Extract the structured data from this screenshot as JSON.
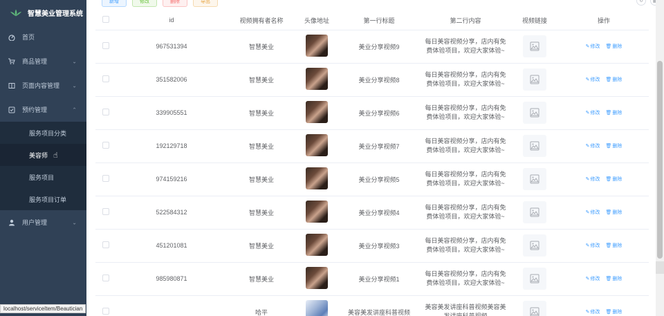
{
  "sidebar": {
    "title": "智慧美业管理系统",
    "menu": [
      {
        "label": "首页",
        "icon": "dashboard-icon"
      },
      {
        "label": "商品管理",
        "icon": "cart-icon"
      },
      {
        "label": "页面内容管理",
        "icon": "book-icon"
      },
      {
        "label": "预约管理",
        "icon": "check-square-icon"
      }
    ],
    "submenu": [
      "服务项目分类",
      "美容师",
      "服务项目",
      "服务项目订单"
    ],
    "user_menu": {
      "label": "用户管理",
      "icon": "user-icon"
    }
  },
  "status_url": "localhost/serviceItem/Beautician",
  "toolbar": {
    "add": "新增",
    "edit": "修改",
    "delete": "删除",
    "export": "导出"
  },
  "table": {
    "headers": [
      "id",
      "视频拥有者名称",
      "头像地址",
      "第一行标题",
      "第二行内容",
      "视频链接",
      "操作"
    ],
    "ops": {
      "edit": "修改",
      "delete": "删除"
    },
    "rows": [
      {
        "id": "967531394",
        "owner": "智慧美业",
        "title": "美业分享视频9",
        "content": "每日美容视频分享，店内有免费体验项目，欢迎大家体验~"
      },
      {
        "id": "351582006",
        "owner": "智慧美业",
        "title": "美业分享视频8",
        "content": "每日美容视频分享，店内有免费体验项目，欢迎大家体验~"
      },
      {
        "id": "339905551",
        "owner": "智慧美业",
        "title": "美业分享视频6",
        "content": "每日美容视频分享，店内有免费体验项目，欢迎大家体验~"
      },
      {
        "id": "192129718",
        "owner": "智慧美业",
        "title": "美业分享视频7",
        "content": "每日美容视频分享，店内有免费体验项目，欢迎大家体验~"
      },
      {
        "id": "974159216",
        "owner": "智慧美业",
        "title": "美业分享视频5",
        "content": "每日美容视频分享，店内有免费体验项目，欢迎大家体验~"
      },
      {
        "id": "522584312",
        "owner": "智慧美业",
        "title": "美业分享视频4",
        "content": "每日美容视频分享，店内有免费体验项目，欢迎大家体验~"
      },
      {
        "id": "451201081",
        "owner": "智慧美业",
        "title": "美业分享视频3",
        "content": "每日美容视频分享，店内有免费体验项目，欢迎大家体验~"
      },
      {
        "id": "985980871",
        "owner": "智慧美业",
        "title": "美业分享视频1",
        "content": "每日美容视频分享，店内有免费体验项目，欢迎大家体验~"
      },
      {
        "id": "",
        "owner": "哈平",
        "title": "美容美发讲座科普视频",
        "content": "美容美发讲座科普视频美容美发讲座科普视频"
      }
    ]
  }
}
